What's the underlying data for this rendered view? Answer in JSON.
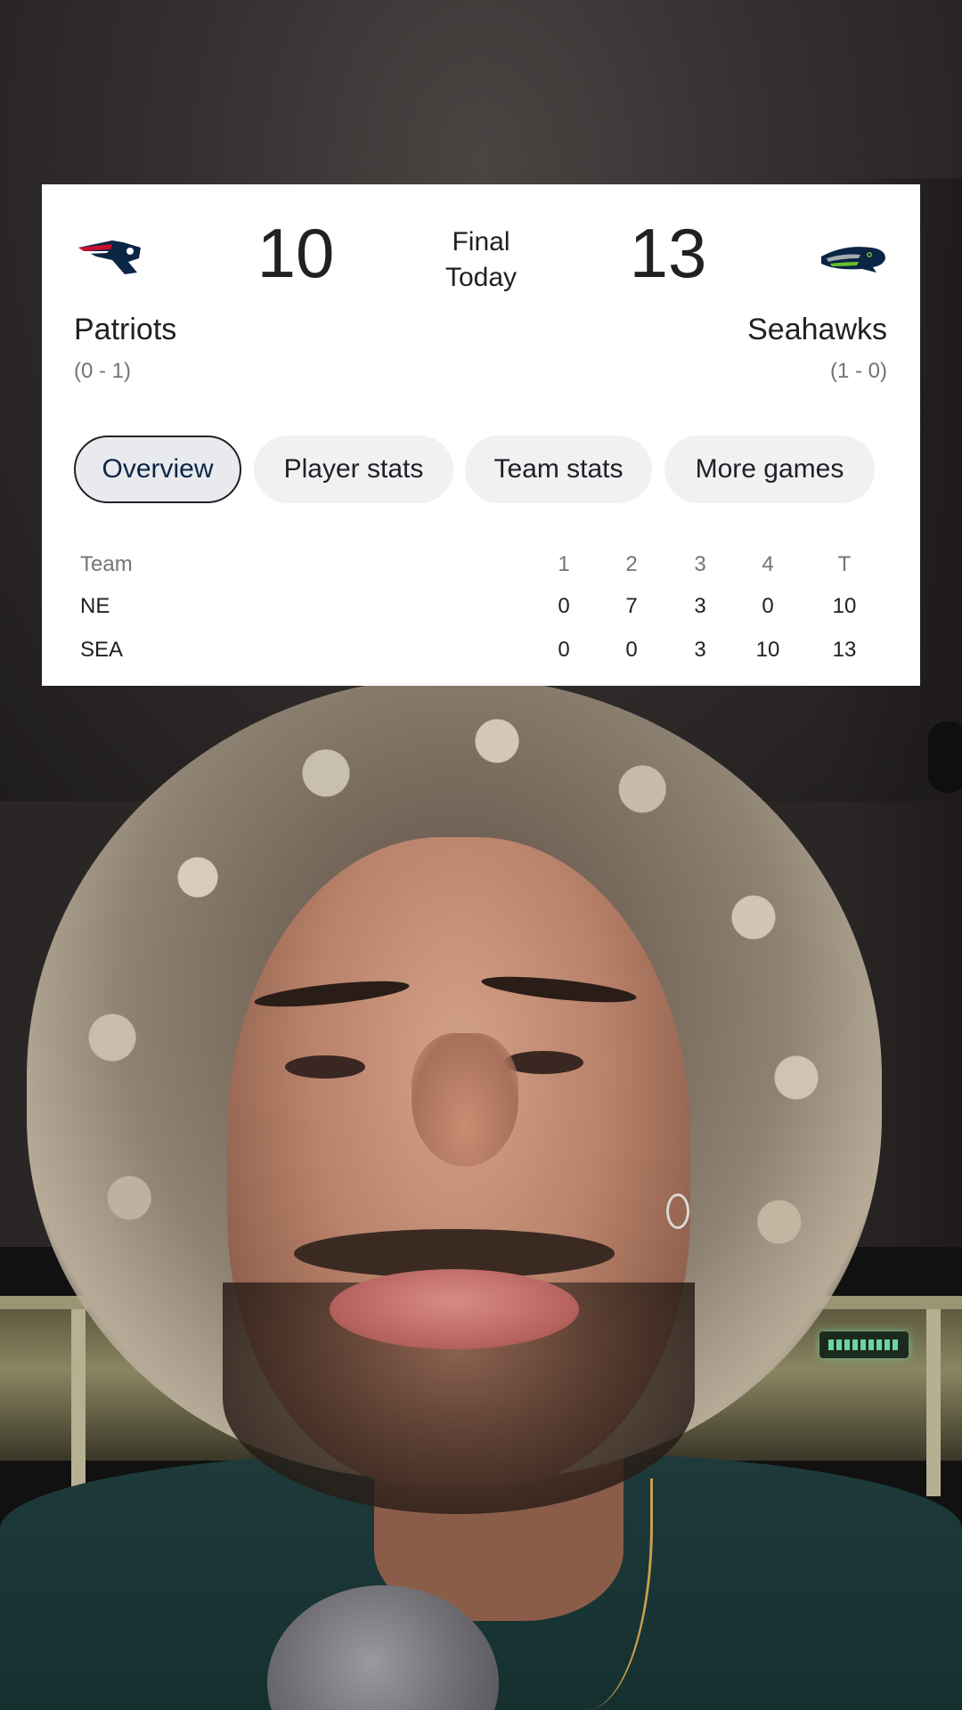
{
  "scoreboard": {
    "status_line1": "Final",
    "status_line2": "Today",
    "home": {
      "name": "Patriots",
      "record": "(0 - 1)",
      "score": "10",
      "logo_icon": "patriots-logo-icon"
    },
    "away": {
      "name": "Seahawks",
      "record": "(1 - 0)",
      "score": "13",
      "logo_icon": "seahawks-logo-icon"
    }
  },
  "tabs": [
    {
      "label": "Overview",
      "active": true
    },
    {
      "label": "Player stats",
      "active": false
    },
    {
      "label": "Team stats",
      "active": false
    },
    {
      "label": "More games",
      "active": false
    }
  ],
  "linescore": {
    "headers": [
      "Team",
      "1",
      "2",
      "3",
      "4",
      "T"
    ],
    "rows": [
      {
        "team": "NE",
        "q": [
          "0",
          "7",
          "3",
          "0",
          "10"
        ]
      },
      {
        "team": "SEA",
        "q": [
          "0",
          "0",
          "3",
          "10",
          "13"
        ]
      }
    ]
  },
  "colors": {
    "patriots_navy": "#0b2545",
    "patriots_red": "#c8102e",
    "seahawks_navy": "#0b2545",
    "seahawks_green": "#69be28",
    "seahawks_gray": "#a5acaf"
  }
}
